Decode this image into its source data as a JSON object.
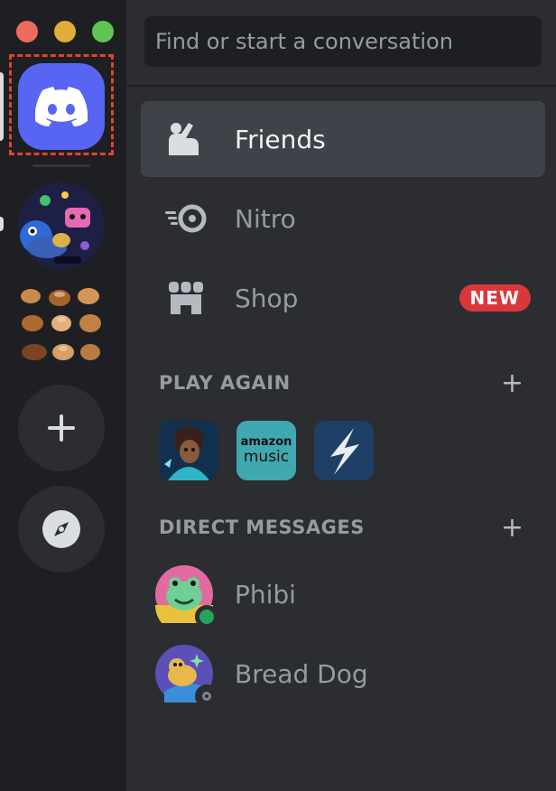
{
  "window": {
    "controls": [
      "close",
      "minimize",
      "maximize"
    ]
  },
  "rail": {
    "home_icon": "discord-logo-icon",
    "servers": [
      {
        "icon": "cartoon-characters-server-icon"
      },
      {
        "icon": "pastries-server-icon"
      }
    ],
    "add_server_icon": "plus-icon",
    "discover_icon": "compass-icon"
  },
  "search": {
    "placeholder": "Find or start a conversation"
  },
  "nav": {
    "friends": "Friends",
    "nitro": "Nitro",
    "shop": "Shop",
    "shop_badge": "NEW"
  },
  "play_again": {
    "title": "PLAY AGAIN",
    "add_icon": "+",
    "games": [
      {
        "icon": "game-character-icon"
      },
      {
        "line1": "amazon",
        "line2": "music"
      },
      {
        "icon": "lightning-bolt-icon"
      }
    ]
  },
  "direct_messages": {
    "title": "DIRECT MESSAGES",
    "add_icon": "+",
    "items": [
      {
        "name": "Phibi",
        "status": "online"
      },
      {
        "name": "Bread Dog",
        "status": "offline"
      }
    ]
  },
  "colors": {
    "blurple": "#5865f2",
    "badge_red": "#da373c",
    "online": "#23a55a"
  }
}
